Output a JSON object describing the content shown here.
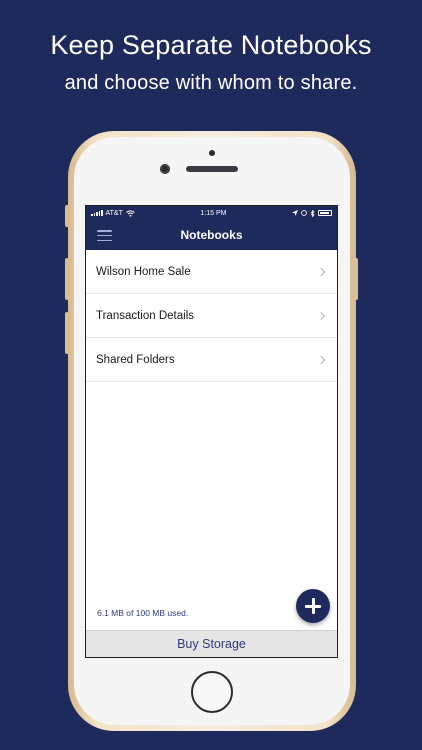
{
  "promo": {
    "headline": "Keep Separate Notebooks",
    "subheadline": "and choose with whom to share."
  },
  "status_bar": {
    "carrier": "AT&T",
    "time": "1:15 PM"
  },
  "nav": {
    "title": "Notebooks",
    "menu_icon": "hamburger-menu-icon"
  },
  "notebooks": [
    {
      "label": "Wilson Home Sale"
    },
    {
      "label": "Transaction Details"
    },
    {
      "label": "Shared Folders"
    }
  ],
  "storage": {
    "usage_text": "6.1 MB of 100 MB used."
  },
  "fab": {
    "icon": "plus-icon"
  },
  "footer": {
    "buy_label": "Buy Storage"
  },
  "colors": {
    "background": "#1f2a5c",
    "accent": "#2d3b78",
    "footer_bg": "#e5e5e5"
  }
}
